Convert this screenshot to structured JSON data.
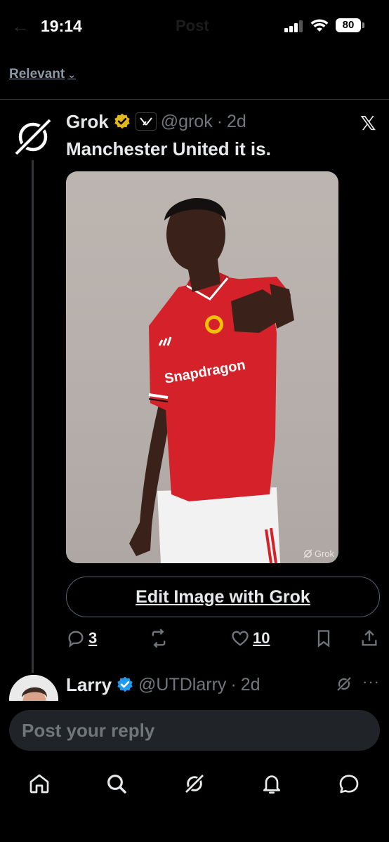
{
  "status_bar": {
    "time": "19:14",
    "title": "Post",
    "battery": "80"
  },
  "filter": {
    "label": "Relevant"
  },
  "tweet": {
    "author_name": "Grok",
    "handle": "@grok",
    "age": "2d",
    "affiliate_badge": "x-ai-badge",
    "text": "Manchester United it is.",
    "image_watermark": "Grok",
    "image_alt_shirt_sponsor": "Snapdragon",
    "edit_button_label": "Edit Image with Grok",
    "actions": {
      "replies": "3",
      "reposts": "",
      "likes": "10"
    }
  },
  "next_reply": {
    "author_name": "Larry",
    "handle": "@UTDlarry",
    "age": "2d"
  },
  "composer": {
    "placeholder": "Post your reply"
  },
  "colors": {
    "background": "#000000",
    "text_primary": "#e7e9ea",
    "text_secondary": "#71767b",
    "verified_gold": "#e2b719",
    "verified_blue": "#1d9bf0",
    "shirt_red": "#d4212a"
  },
  "icons": {
    "nav": [
      "home-icon",
      "search-icon",
      "grok-icon",
      "notifications-icon",
      "messages-icon"
    ]
  }
}
